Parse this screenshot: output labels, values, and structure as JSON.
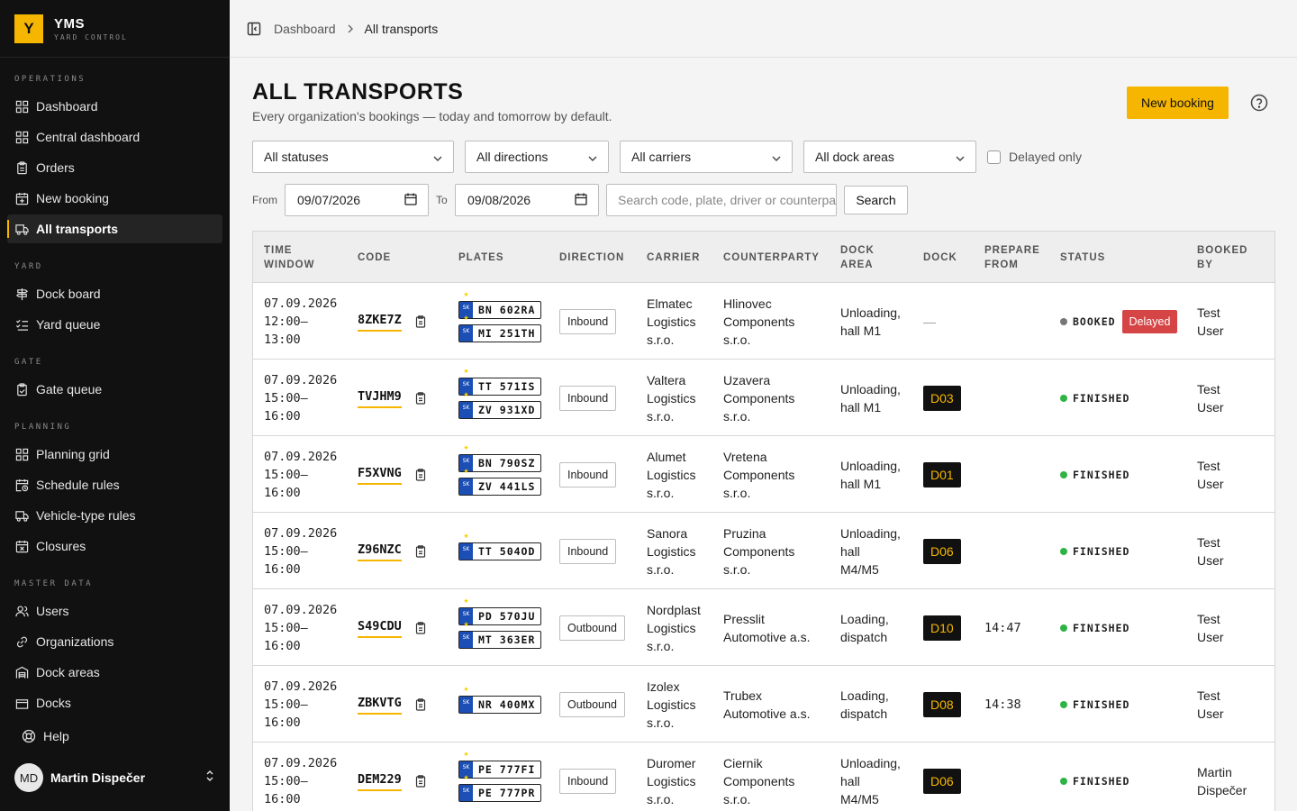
{
  "brand": {
    "logo": "Y",
    "name": "YMS",
    "subtitle": "YARD CONTROL"
  },
  "sidebar": {
    "sections": [
      {
        "title": "OPERATIONS",
        "items": [
          {
            "label": "Dashboard",
            "icon": "grid-icon"
          },
          {
            "label": "Central dashboard",
            "icon": "grid-icon"
          },
          {
            "label": "Orders",
            "icon": "clipboard-icon"
          },
          {
            "label": "New booking",
            "icon": "calendar-plus-icon"
          },
          {
            "label": "All transports",
            "icon": "truck-icon",
            "active": true
          }
        ]
      },
      {
        "title": "YARD",
        "items": [
          {
            "label": "Dock board",
            "icon": "signpost-icon"
          },
          {
            "label": "Yard queue",
            "icon": "list-check-icon"
          }
        ]
      },
      {
        "title": "GATE",
        "items": [
          {
            "label": "Gate queue",
            "icon": "clipboard-check-icon"
          }
        ]
      },
      {
        "title": "PLANNING",
        "items": [
          {
            "label": "Planning grid",
            "icon": "grid-icon"
          },
          {
            "label": "Schedule rules",
            "icon": "calendar-clock-icon"
          },
          {
            "label": "Vehicle-type rules",
            "icon": "truck-icon"
          },
          {
            "label": "Closures",
            "icon": "calendar-x-icon"
          }
        ]
      },
      {
        "title": "MASTER DATA",
        "items": [
          {
            "label": "Users",
            "icon": "users-icon"
          },
          {
            "label": "Organizations",
            "icon": "link-icon"
          },
          {
            "label": "Dock areas",
            "icon": "warehouse-icon"
          },
          {
            "label": "Docks",
            "icon": "dock-icon"
          }
        ]
      }
    ],
    "help": "Help",
    "user": {
      "initials": "MD",
      "name": "Martin Dispečer"
    }
  },
  "breadcrumb": {
    "home": "Dashboard",
    "current": "All transports"
  },
  "page": {
    "title": "ALL TRANSPORTS",
    "subtitle": "Every organization's bookings — today and tomorrow by default.",
    "new_booking": "New booking"
  },
  "filters": {
    "status": "All statuses",
    "direction": "All directions",
    "carrier": "All carriers",
    "dock_area": "All dock areas",
    "delayed_only": "Delayed only",
    "from_label": "From",
    "from_value": "09/07/2026",
    "to_label": "To",
    "to_value": "09/08/2026",
    "search_placeholder": "Search code, plate, driver or counterparty",
    "search_button": "Search"
  },
  "table": {
    "headers": {
      "time_window": [
        "TIME",
        "WINDOW"
      ],
      "code": "CODE",
      "plates": "PLATES",
      "direction": "DIRECTION",
      "carrier": "CARRIER",
      "counterparty": "COUNTERPARTY",
      "dock_area": [
        "DOCK",
        "AREA"
      ],
      "dock": "DOCK",
      "prepare_from": [
        "PREPARE",
        "FROM"
      ],
      "status": "STATUS",
      "booked_by": [
        "BOOKED",
        "BY"
      ]
    },
    "plate_country": "SK",
    "rows": [
      {
        "date": "07.09.2026",
        "start": "12:00–",
        "end": "13:00",
        "code": "8ZKE7Z",
        "plates": [
          "BN 602RA",
          "MI 251TH"
        ],
        "direction": "Inbound",
        "carrier": [
          "Elmatec",
          "Logistics",
          "s.r.o."
        ],
        "counterparty": [
          "Hlinovec",
          "Components",
          "s.r.o."
        ],
        "dock_area": [
          "Unloading,",
          "hall M1"
        ],
        "dock": "",
        "no_dock": "—",
        "prepare_from": "",
        "status": "BOOKED",
        "status_color": "#777777",
        "delayed": "Delayed",
        "booked_by": [
          "Test",
          "User"
        ]
      },
      {
        "date": "07.09.2026",
        "start": "15:00–",
        "end": "16:00",
        "code": "TVJHM9",
        "plates": [
          "TT 571IS",
          "ZV 931XD"
        ],
        "direction": "Inbound",
        "carrier": [
          "Valtera",
          "Logistics",
          "s.r.o."
        ],
        "counterparty": [
          "Uzavera",
          "Components",
          "s.r.o."
        ],
        "dock_area": [
          "Unloading,",
          "hall M1"
        ],
        "dock": "D03",
        "prepare_from": "",
        "status": "FINISHED",
        "status_color": "#2fb344",
        "booked_by": [
          "Test",
          "User"
        ]
      },
      {
        "date": "07.09.2026",
        "start": "15:00–",
        "end": "16:00",
        "code": "F5XVNG",
        "plates": [
          "BN 790SZ",
          "ZV 441LS"
        ],
        "direction": "Inbound",
        "carrier": [
          "Alumet",
          "Logistics",
          "s.r.o."
        ],
        "counterparty": [
          "Vretena",
          "Components",
          "s.r.o."
        ],
        "dock_area": [
          "Unloading,",
          "hall M1"
        ],
        "dock": "D01",
        "prepare_from": "",
        "status": "FINISHED",
        "status_color": "#2fb344",
        "booked_by": [
          "Test",
          "User"
        ]
      },
      {
        "date": "07.09.2026",
        "start": "15:00–",
        "end": "16:00",
        "code": "Z96NZC",
        "plates": [
          "TT 504OD"
        ],
        "direction": "Inbound",
        "carrier": [
          "Sanora",
          "Logistics",
          "s.r.o."
        ],
        "counterparty": [
          "Pruzina",
          "Components",
          "s.r.o."
        ],
        "dock_area": [
          "Unloading,",
          "hall",
          "M4/M5"
        ],
        "dock": "D06",
        "prepare_from": "",
        "status": "FINISHED",
        "status_color": "#2fb344",
        "booked_by": [
          "Test",
          "User"
        ]
      },
      {
        "date": "07.09.2026",
        "start": "15:00–",
        "end": "16:00",
        "code": "S49CDU",
        "plates": [
          "PD 570JU",
          "MT 363ER"
        ],
        "direction": "Outbound",
        "carrier": [
          "Nordplast",
          "Logistics",
          "s.r.o."
        ],
        "counterparty": [
          "Presslit",
          "Automotive a.s."
        ],
        "dock_area": [
          "Loading,",
          "dispatch"
        ],
        "dock": "D10",
        "prepare_from": "14:47",
        "status": "FINISHED",
        "status_color": "#2fb344",
        "booked_by": [
          "Test",
          "User"
        ]
      },
      {
        "date": "07.09.2026",
        "start": "15:00–",
        "end": "16:00",
        "code": "ZBKVTG",
        "plates": [
          "NR 400MX"
        ],
        "direction": "Outbound",
        "carrier": [
          "Izolex",
          "Logistics",
          "s.r.o."
        ],
        "counterparty": [
          "Trubex",
          "Automotive a.s."
        ],
        "dock_area": [
          "Loading,",
          "dispatch"
        ],
        "dock": "D08",
        "prepare_from": "14:38",
        "status": "FINISHED",
        "status_color": "#2fb344",
        "booked_by": [
          "Test",
          "User"
        ]
      },
      {
        "date": "07.09.2026",
        "start": "15:00–",
        "end": "16:00",
        "code": "DEM229",
        "plates": [
          "PE 777FI",
          "PE 777PR"
        ],
        "direction": "Inbound",
        "carrier": [
          "Duromer",
          "Logistics",
          "s.r.o."
        ],
        "counterparty": [
          "Ciernik",
          "Components",
          "s.r.o."
        ],
        "dock_area": [
          "Unloading,",
          "hall",
          "M4/M5"
        ],
        "dock": "D06",
        "prepare_from": "",
        "status": "FINISHED",
        "status_color": "#2fb344",
        "booked_by": [
          "Martin",
          "Dispečer"
        ]
      }
    ]
  },
  "colors": {
    "accent": "#f6b600",
    "sidebar_bg": "#111111",
    "finished": "#2fb344",
    "delayed": "#d64545"
  }
}
